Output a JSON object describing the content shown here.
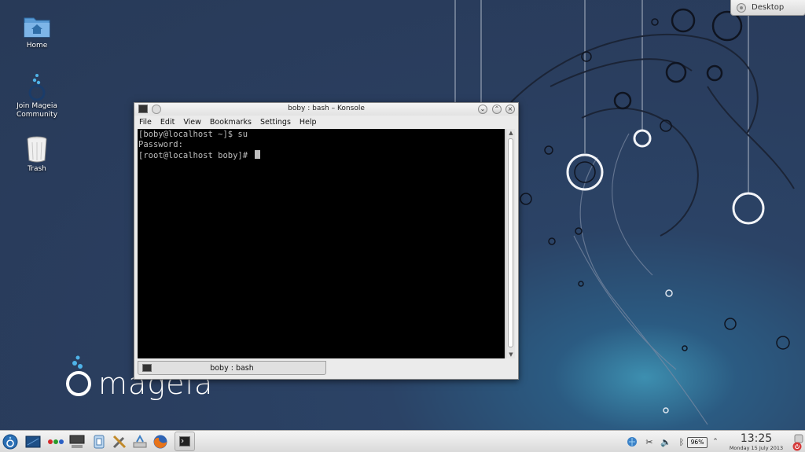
{
  "desktop": {
    "icons": [
      {
        "label": "Home",
        "icon": "home-folder-icon"
      },
      {
        "label": "Join Mageia Community",
        "label_line1": "Join Mageia",
        "label_line2": "Community",
        "icon": "mageia-community-icon"
      },
      {
        "label": "Trash",
        "icon": "trash-icon"
      }
    ],
    "desktop_button_label": "Desktop",
    "logo_text": "mageia"
  },
  "konsole": {
    "title": "boby : bash – Konsole",
    "menu": [
      "File",
      "Edit",
      "View",
      "Bookmarks",
      "Settings",
      "Help"
    ],
    "terminal_lines": [
      "[boby@localhost ~]$ su",
      "Password:",
      "[root@localhost boby]# "
    ],
    "tab_label": "boby : bash"
  },
  "taskbar": {
    "launchers": [
      "mageia-menu-icon",
      "show-desktop-icon",
      "activities-icon",
      "system-monitor-icon",
      "package-icon",
      "tools-icon",
      "network-icon",
      "firefox-icon"
    ],
    "active_task": "konsole-icon",
    "tray": [
      "network-status-icon",
      "klipper-icon",
      "volume-icon",
      "bluetooth-icon"
    ],
    "battery_percent": "96%",
    "clock_time": "13:25",
    "clock_date": "Monday 15 July 2013"
  },
  "colors": {
    "desktop_bg": "#2a3e5f",
    "terminal_bg": "#000000",
    "terminal_fg": "#bfbfbf"
  }
}
